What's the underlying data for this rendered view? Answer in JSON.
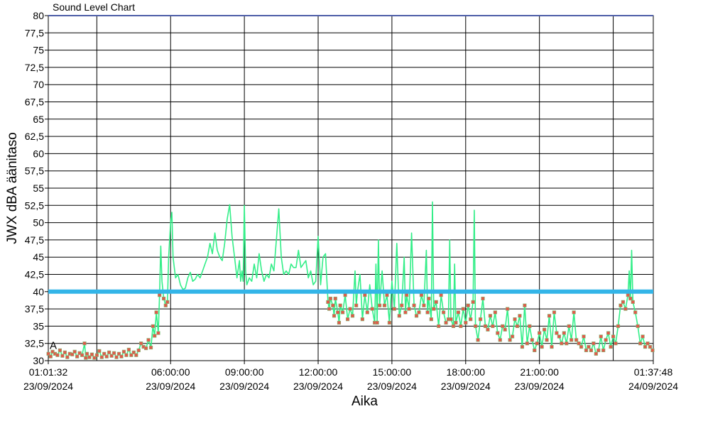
{
  "chart_data": {
    "type": "line",
    "title": "Sound Level Chart",
    "xlabel": "Aika",
    "ylabel": "JWX dBA äänitaso",
    "ylim": [
      30,
      80
    ],
    "y_ticks": [
      "30",
      "32,5",
      "35",
      "37,5",
      "40",
      "42,5",
      "45",
      "47,5",
      "50",
      "52,5",
      "55",
      "57,5",
      "60",
      "62,5",
      "65",
      "67,5",
      "70",
      "72,5",
      "75",
      "77,5",
      "80"
    ],
    "x_ticks": [
      {
        "time": "01:01:32",
        "date": "23/09/2024",
        "hour": 1.0256
      },
      {
        "time": "06:00:00",
        "date": "23/09/2024",
        "hour": 6
      },
      {
        "time": "09:00:00",
        "date": "23/09/2024",
        "hour": 9
      },
      {
        "time": "12:00:00",
        "date": "23/09/2024",
        "hour": 12
      },
      {
        "time": "15:00:00",
        "date": "23/09/2024",
        "hour": 15
      },
      {
        "time": "18:00:00",
        "date": "23/09/2024",
        "hour": 18
      },
      {
        "time": "21:00:00",
        "date": "23/09/2024",
        "hour": 21
      },
      {
        "time": "01:37:48",
        "date": "24/09/2024",
        "hour": 25.63
      }
    ],
    "vertical_grid_hours": [
      3,
      6,
      9,
      12,
      15,
      18,
      21,
      24
    ],
    "xlim_hours": [
      1.0256,
      25.63
    ],
    "grid": true,
    "threshold": {
      "value": 40,
      "color": "#33b5e8"
    },
    "top_reference": {
      "value": 80,
      "color": "#4d5ea8"
    },
    "series_label": "A",
    "series": [
      {
        "color": "#33ee88",
        "marker_color": "#e05a4a",
        "points": [
          [
            1.03,
            31.0
          ],
          [
            1.12,
            30.6
          ],
          [
            1.2,
            31.3
          ],
          [
            1.3,
            31.0
          ],
          [
            1.4,
            30.8
          ],
          [
            1.5,
            31.5
          ],
          [
            1.6,
            30.7
          ],
          [
            1.7,
            31.2
          ],
          [
            1.8,
            30.5
          ],
          [
            1.9,
            31.0
          ],
          [
            2.0,
            30.9
          ],
          [
            2.1,
            31.3
          ],
          [
            2.2,
            30.6
          ],
          [
            2.3,
            31.1
          ],
          [
            2.4,
            30.8
          ],
          [
            2.5,
            32.5
          ],
          [
            2.55,
            30.4
          ],
          [
            2.6,
            31.0
          ],
          [
            2.7,
            30.5
          ],
          [
            2.8,
            30.9
          ],
          [
            2.9,
            30.4
          ],
          [
            3.0,
            30.8
          ],
          [
            3.1,
            31.4
          ],
          [
            3.2,
            30.5
          ],
          [
            3.3,
            31.0
          ],
          [
            3.4,
            30.6
          ],
          [
            3.5,
            31.2
          ],
          [
            3.6,
            30.7
          ],
          [
            3.7,
            31.1
          ],
          [
            3.8,
            30.5
          ],
          [
            3.9,
            31.0
          ],
          [
            4.0,
            30.6
          ],
          [
            4.1,
            31.3
          ],
          [
            4.2,
            30.8
          ],
          [
            4.3,
            31.6
          ],
          [
            4.4,
            30.8
          ],
          [
            4.5,
            31.2
          ],
          [
            4.6,
            30.8
          ],
          [
            4.7,
            31.5
          ],
          [
            4.8,
            32.5
          ],
          [
            4.9,
            32.0
          ],
          [
            5.0,
            31.8
          ],
          [
            5.1,
            33.0
          ],
          [
            5.2,
            31.9
          ],
          [
            5.28,
            35.0
          ],
          [
            5.35,
            33.6
          ],
          [
            5.42,
            37.0
          ],
          [
            5.5,
            34.0
          ],
          [
            5.55,
            39.5
          ],
          [
            5.6,
            46.6
          ],
          [
            5.65,
            41.5
          ],
          [
            5.72,
            39.0
          ],
          [
            5.8,
            38.0
          ],
          [
            5.87,
            38.5
          ],
          [
            5.92,
            45.0
          ],
          [
            6.0,
            50.0
          ],
          [
            6.05,
            51.5
          ],
          [
            6.1,
            45.0
          ],
          [
            6.2,
            42.0
          ],
          [
            6.3,
            42.5
          ],
          [
            6.4,
            41.0
          ],
          [
            6.5,
            40.3
          ],
          [
            6.6,
            40.5
          ],
          [
            6.7,
            42.0
          ],
          [
            6.8,
            42.8
          ],
          [
            6.9,
            41.5
          ],
          [
            7.0,
            41.8
          ],
          [
            7.1,
            42.5
          ],
          [
            7.2,
            42.0
          ],
          [
            7.3,
            43.0
          ],
          [
            7.4,
            44.0
          ],
          [
            7.5,
            45.0
          ],
          [
            7.6,
            47.0
          ],
          [
            7.7,
            45.5
          ],
          [
            7.8,
            48.5
          ],
          [
            7.9,
            46.0
          ],
          [
            8.0,
            45.0
          ],
          [
            8.1,
            44.5
          ],
          [
            8.2,
            47.0
          ],
          [
            8.3,
            50.5
          ],
          [
            8.4,
            52.6
          ],
          [
            8.5,
            48.0
          ],
          [
            8.6,
            45.0
          ],
          [
            8.7,
            42.0
          ],
          [
            8.8,
            44.5
          ],
          [
            8.85,
            41.5
          ],
          [
            8.9,
            43.0
          ],
          [
            8.95,
            41.5
          ],
          [
            9.0,
            52.5
          ],
          [
            9.05,
            43.0
          ],
          [
            9.1,
            41.0
          ],
          [
            9.2,
            42.0
          ],
          [
            9.3,
            41.5
          ],
          [
            9.4,
            44.0
          ],
          [
            9.5,
            42.0
          ],
          [
            9.6,
            45.5
          ],
          [
            9.7,
            43.0
          ],
          [
            9.8,
            41.5
          ],
          [
            9.9,
            42.5
          ],
          [
            10.0,
            42.0
          ],
          [
            10.1,
            44.0
          ],
          [
            10.2,
            43.0
          ],
          [
            10.3,
            47.5
          ],
          [
            10.4,
            52.0
          ],
          [
            10.5,
            45.0
          ],
          [
            10.6,
            42.5
          ],
          [
            10.7,
            43.0
          ],
          [
            10.8,
            42.5
          ],
          [
            10.9,
            44.0
          ],
          [
            11.0,
            43.5
          ],
          [
            11.1,
            43.5
          ],
          [
            11.2,
            46.0
          ],
          [
            11.3,
            43.5
          ],
          [
            11.4,
            44.0
          ],
          [
            11.5,
            44.5
          ],
          [
            11.6,
            42.0
          ],
          [
            11.7,
            43.0
          ],
          [
            11.8,
            41.0
          ],
          [
            11.9,
            41.5
          ],
          [
            12.0,
            48.0
          ],
          [
            12.1,
            41.0
          ],
          [
            12.2,
            45.0
          ],
          [
            12.3,
            45.5
          ],
          [
            12.4,
            38.5
          ],
          [
            12.45,
            37.5
          ],
          [
            12.5,
            39.0
          ],
          [
            12.6,
            38.0
          ],
          [
            12.65,
            36.5
          ],
          [
            12.7,
            39.0
          ],
          [
            12.8,
            37.0
          ],
          [
            12.85,
            35.5
          ],
          [
            12.9,
            38.0
          ],
          [
            13.0,
            37.0
          ],
          [
            13.1,
            39.5
          ],
          [
            13.2,
            36.0
          ],
          [
            13.3,
            37.5
          ],
          [
            13.4,
            36.5
          ],
          [
            13.5,
            43.0
          ],
          [
            13.55,
            38.0
          ],
          [
            13.6,
            40.0
          ],
          [
            13.7,
            42.5
          ],
          [
            13.8,
            36.0
          ],
          [
            13.9,
            39.5
          ],
          [
            14.0,
            37.0
          ],
          [
            14.1,
            41.0
          ],
          [
            14.2,
            37.5
          ],
          [
            14.3,
            35.5
          ],
          [
            14.35,
            44.0
          ],
          [
            14.4,
            35.5
          ],
          [
            14.45,
            47.5
          ],
          [
            14.5,
            38.0
          ],
          [
            14.6,
            43.0
          ],
          [
            14.7,
            38.0
          ],
          [
            14.8,
            39.5
          ],
          [
            14.9,
            35.5
          ],
          [
            15.0,
            41.5
          ],
          [
            15.1,
            37.5
          ],
          [
            15.2,
            47.0
          ],
          [
            15.3,
            36.5
          ],
          [
            15.4,
            38.0
          ],
          [
            15.5,
            45.0
          ],
          [
            15.55,
            37.0
          ],
          [
            15.6,
            39.5
          ],
          [
            15.7,
            37.5
          ],
          [
            15.8,
            48.5
          ],
          [
            15.9,
            38.0
          ],
          [
            16.0,
            36.5
          ],
          [
            16.1,
            37.0
          ],
          [
            16.2,
            39.5
          ],
          [
            16.3,
            38.0
          ],
          [
            16.4,
            46.0
          ],
          [
            16.45,
            37.0
          ],
          [
            16.5,
            39.0
          ],
          [
            16.6,
            36.0
          ],
          [
            16.65,
            53.0
          ],
          [
            16.7,
            37.5
          ],
          [
            16.8,
            38.5
          ],
          [
            16.9,
            35.0
          ],
          [
            17.0,
            39.5
          ],
          [
            17.1,
            37.0
          ],
          [
            17.2,
            35.5
          ],
          [
            17.3,
            36.0
          ],
          [
            17.35,
            47.5
          ],
          [
            17.4,
            36.0
          ],
          [
            17.5,
            35.0
          ],
          [
            17.55,
            44.0
          ],
          [
            17.6,
            35.5
          ],
          [
            17.7,
            37.0
          ],
          [
            17.8,
            35.0
          ],
          [
            17.9,
            37.5
          ],
          [
            18.0,
            35.5
          ],
          [
            18.1,
            38.0
          ],
          [
            18.2,
            36.0
          ],
          [
            18.3,
            38.5
          ],
          [
            18.35,
            51.8
          ],
          [
            18.4,
            35.0
          ],
          [
            18.5,
            33.0
          ],
          [
            18.6,
            36.0
          ],
          [
            18.7,
            39.0
          ],
          [
            18.8,
            35.0
          ],
          [
            18.9,
            34.5
          ],
          [
            19.0,
            36.5
          ],
          [
            19.1,
            35.0
          ],
          [
            19.2,
            37.0
          ],
          [
            19.3,
            34.0
          ],
          [
            19.4,
            33.0
          ],
          [
            19.5,
            35.0
          ],
          [
            19.6,
            34.5
          ],
          [
            19.7,
            37.5
          ],
          [
            19.8,
            33.0
          ],
          [
            19.9,
            33.5
          ],
          [
            20.0,
            36.0
          ],
          [
            20.1,
            35.0
          ],
          [
            20.2,
            36.5
          ],
          [
            20.3,
            32.0
          ],
          [
            20.4,
            38.0
          ],
          [
            20.5,
            32.5
          ],
          [
            20.6,
            35.0
          ],
          [
            20.7,
            33.0
          ],
          [
            20.8,
            31.5
          ],
          [
            20.9,
            32.5
          ],
          [
            21.0,
            34.0
          ],
          [
            21.1,
            32.0
          ],
          [
            21.2,
            34.5
          ],
          [
            21.3,
            33.0
          ],
          [
            21.4,
            36.5
          ],
          [
            21.5,
            32.0
          ],
          [
            21.6,
            37.0
          ],
          [
            21.7,
            34.0
          ],
          [
            21.8,
            33.5
          ],
          [
            21.9,
            32.5
          ],
          [
            22.0,
            34.0
          ],
          [
            22.1,
            32.5
          ],
          [
            22.2,
            35.0
          ],
          [
            22.3,
            33.0
          ],
          [
            22.4,
            37.0
          ],
          [
            22.5,
            33.0
          ],
          [
            22.6,
            32.5
          ],
          [
            22.7,
            32.0
          ],
          [
            22.8,
            33.5
          ],
          [
            22.9,
            31.5
          ],
          [
            23.0,
            32.0
          ],
          [
            23.1,
            31.5
          ],
          [
            23.2,
            32.5
          ],
          [
            23.3,
            31.0
          ],
          [
            23.4,
            31.5
          ],
          [
            23.5,
            33.5
          ],
          [
            23.6,
            31.5
          ],
          [
            23.7,
            33.0
          ],
          [
            23.8,
            34.0
          ],
          [
            23.9,
            32.0
          ],
          [
            24.0,
            33.5
          ],
          [
            24.1,
            32.5
          ],
          [
            24.2,
            35.0
          ],
          [
            24.3,
            38.0
          ],
          [
            24.4,
            38.5
          ],
          [
            24.5,
            37.5
          ],
          [
            24.6,
            39.5
          ],
          [
            24.65,
            43.0
          ],
          [
            24.7,
            39.0
          ],
          [
            24.75,
            46.0
          ],
          [
            24.8,
            38.5
          ],
          [
            24.9,
            37.0
          ],
          [
            25.0,
            35.0
          ],
          [
            25.1,
            32.5
          ],
          [
            25.2,
            33.5
          ],
          [
            25.3,
            32.0
          ],
          [
            25.4,
            32.5
          ],
          [
            25.5,
            32.0
          ],
          [
            25.6,
            31.5
          ]
        ]
      }
    ]
  }
}
